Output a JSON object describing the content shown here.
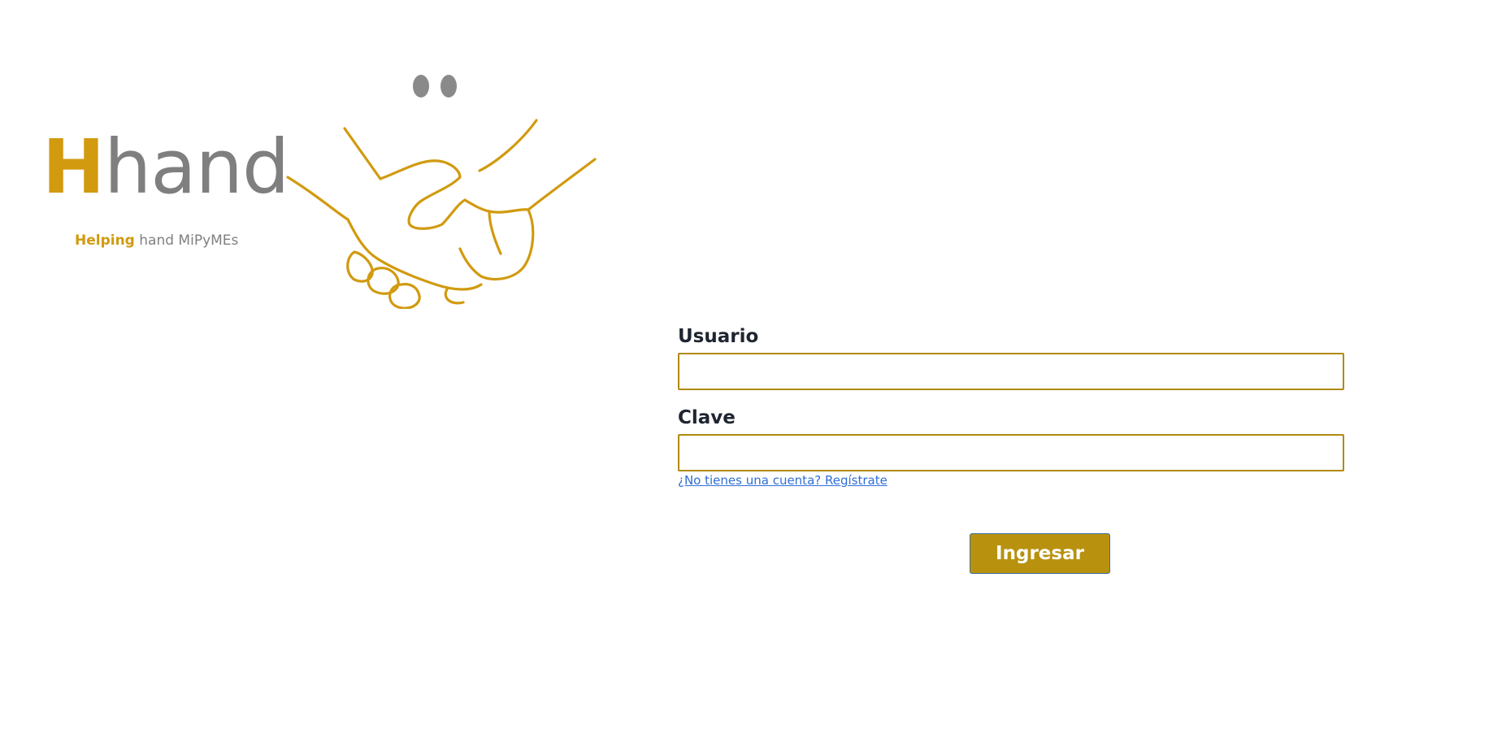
{
  "brand": {
    "logo_initial": "H",
    "logo_rest": "hand",
    "tagline_accent": "Helping",
    "tagline_rest": " hand MiPyMEs",
    "accent_color": "#d19a0f",
    "gray_color": "#7f7f7f"
  },
  "login": {
    "username_label": "Usuario",
    "username_value": "",
    "password_label": "Clave",
    "password_value": "",
    "register_link": "¿No tienes una cuenta? Regístrate",
    "submit_label": "Ingresar",
    "input_border_color": "#b08a14",
    "button_color": "#b8920f",
    "link_color": "#2f6fd6"
  }
}
